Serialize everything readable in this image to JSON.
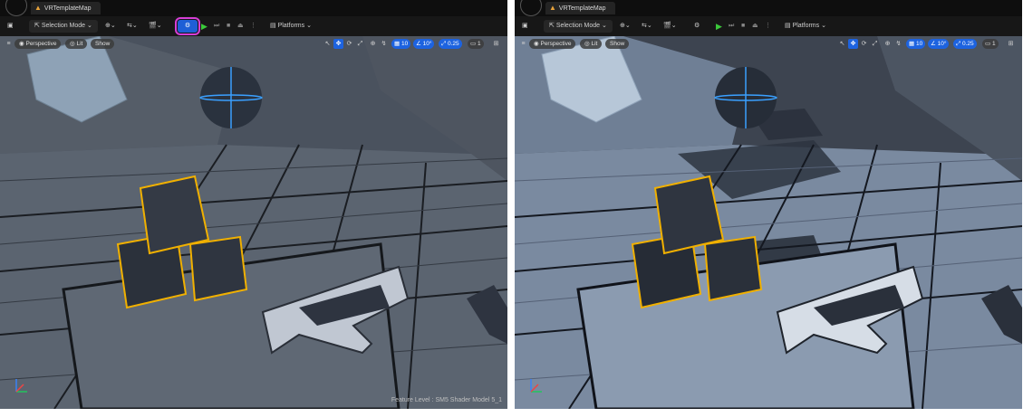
{
  "left": {
    "map_tab": "VRTemplateMap",
    "toolbar": {
      "selection_mode": "Selection Mode ⌄",
      "platforms": "Platforms ⌄"
    },
    "viewport": {
      "perspective": "Perspective",
      "lit": "Lit",
      "show": "Show",
      "grid_snap": "10",
      "rot_snap": "10°",
      "scale_snap": "0.25",
      "camera_speed": "1",
      "footer": "Feature Level : SM5 Shader Model 5_1"
    }
  },
  "right": {
    "map_tab": "VRTemplateMap",
    "toolbar": {
      "selection_mode": "Selection Mode ⌄",
      "platforms": "Platforms ⌄"
    },
    "viewport": {
      "perspective": "Perspective",
      "lit": "Lit",
      "show": "Show",
      "grid_snap": "10",
      "rot_snap": "10°",
      "scale_snap": "0.25",
      "camera_speed": "1"
    }
  },
  "colors": {
    "highlight_outline": "#d63fd6",
    "accent_blue": "#1d63e0",
    "play_green": "#3bc93b",
    "selection_orange": "#f0b000"
  }
}
